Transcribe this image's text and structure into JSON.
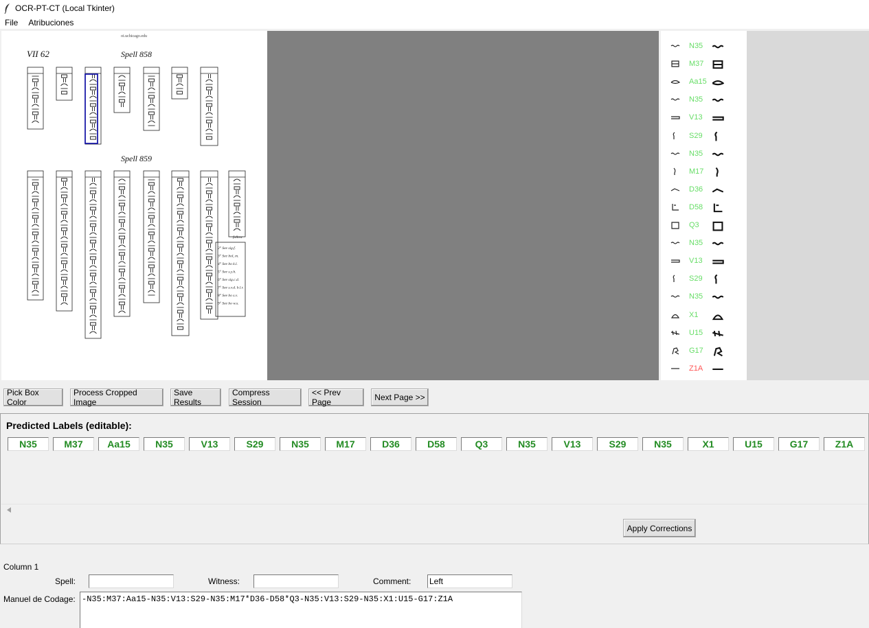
{
  "window": {
    "title": "OCR-PT-CT (Local Tkinter)"
  },
  "menu": {
    "items": [
      "File",
      "Atribuciones"
    ]
  },
  "document": {
    "source": "oi.uchicago.edu",
    "page_mark": "VII 62",
    "spell_a": "Spell 858",
    "spell_b": "Spell 859",
    "notes": [
      "2° See sig.f.",
      "3° See bol, m.",
      "4° See bo k.l.",
      "5° See s.y.h.",
      "6° See sig.c.d.",
      "7° See s.v.d. b.l.r.",
      "8° See bo s.v.",
      "9° See bo w.x."
    ],
    "follows": "follow"
  },
  "glyph_panel": {
    "rows": [
      {
        "label": "N35",
        "color": "green"
      },
      {
        "label": "M37",
        "color": "green"
      },
      {
        "label": "Aa15",
        "color": "green"
      },
      {
        "label": "N35",
        "color": "green"
      },
      {
        "label": "V13",
        "color": "green"
      },
      {
        "label": "S29",
        "color": "green"
      },
      {
        "label": "N35",
        "color": "green"
      },
      {
        "label": "M17",
        "color": "green"
      },
      {
        "label": "D36",
        "color": "green"
      },
      {
        "label": "D58",
        "color": "green"
      },
      {
        "label": "Q3",
        "color": "green"
      },
      {
        "label": "N35",
        "color": "green"
      },
      {
        "label": "V13",
        "color": "green"
      },
      {
        "label": "S29",
        "color": "green"
      },
      {
        "label": "N35",
        "color": "green"
      },
      {
        "label": "X1",
        "color": "green"
      },
      {
        "label": "U15",
        "color": "green"
      },
      {
        "label": "G17",
        "color": "green"
      },
      {
        "label": "Z1A",
        "color": "red"
      }
    ]
  },
  "toolbar": {
    "pick_box_color": "Pick Box Color",
    "process_cropped": "Process Cropped Image",
    "save_results": "Save Results",
    "compress_session": "Compress Session",
    "prev_page": "<< Prev Page",
    "next_page": "Next Page >>"
  },
  "predicted": {
    "title": "Predicted Labels (editable):",
    "labels": [
      "N35",
      "M37",
      "Aa15",
      "N35",
      "V13",
      "S29",
      "N35",
      "M17",
      "D36",
      "D58",
      "Q3",
      "N35",
      "V13",
      "S29",
      "N35",
      "X1",
      "U15",
      "G17",
      "Z1A"
    ],
    "apply_label": "Apply Corrections"
  },
  "form": {
    "column_label": "Column 1",
    "spell_label": "Spell:",
    "spell_value": "",
    "witness_label": "Witness:",
    "witness_value": "",
    "comment_label": "Comment:",
    "comment_value": "Left",
    "mdc_label": "Manuel de Codage:",
    "mdc_value": "-N35:M37:Aa15-N35:V13:S29-N35:M17*D36-D58*Q3-N35:V13:S29-N35:X1:U15-G17:Z1A"
  },
  "colors": {
    "label_green": "#228b22",
    "panel_green": "#66dd66",
    "panel_red": "#ff5555",
    "selection_box": "#1a1aa8",
    "canvas_gray": "#808080"
  }
}
